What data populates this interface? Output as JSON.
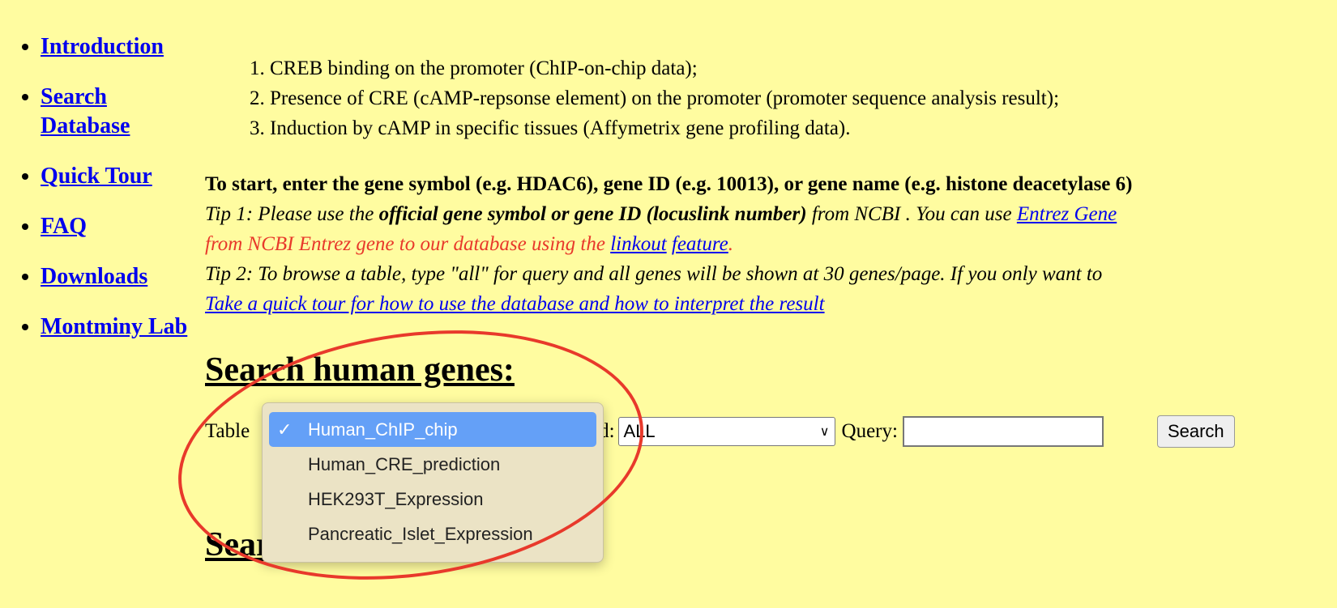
{
  "sidebar": {
    "items": [
      {
        "label": "Introduction"
      },
      {
        "label": "Search Database"
      },
      {
        "label": "Quick Tour"
      },
      {
        "label": "FAQ"
      },
      {
        "label": "Downloads"
      },
      {
        "label": "Montminy Lab"
      }
    ]
  },
  "criteria": [
    "CREB binding on the promoter (ChIP-on-chip data);",
    "Presence of CRE (cAMP-repsonse element) on the promoter (promoter sequence analysis result);",
    "Induction by cAMP in specific tissues (Affymetrix gene profiling data)."
  ],
  "start_text": "To start, enter the gene symbol (e.g. HDAC6), gene ID (e.g. 10013), or gene name (e.g. histone deacetylase 6)",
  "tip1": {
    "prefix": "Tip 1: Please use the ",
    "bold": "official gene symbol or gene ID (locuslink number)",
    "middle": " from NCBI . You can use ",
    "link": "Entrez Gene",
    "red_text": "from NCBI Entrez gene to our database using the ",
    "link2": "linkout",
    "link3": "feature",
    "end": "."
  },
  "tip2": "Tip 2: To browse a table, type \"all\" for query and all genes will be shown at 30 genes/page. If you only want to",
  "tour_link": "Take a quick tour for how to use the database and how to interpret the result",
  "human_heading": "Search human genes:",
  "form": {
    "table_label": "Table",
    "field_label": "Field:",
    "field_value": "ALL",
    "query_label": "Query:",
    "query_value": "",
    "search_label": "Search"
  },
  "dropdown": {
    "check": "✓",
    "options": [
      "Human_ChIP_chip",
      "Human_CRE_prediction",
      "HEK293T_Expression",
      "Pancreatic_Islet_Expression"
    ],
    "selected": "Human_ChIP_chip"
  },
  "second_heading": "Search mouse genes:",
  "colors": {
    "background": "#fffca0",
    "annotation": "#e8392b",
    "highlight": "#64a0f7"
  }
}
